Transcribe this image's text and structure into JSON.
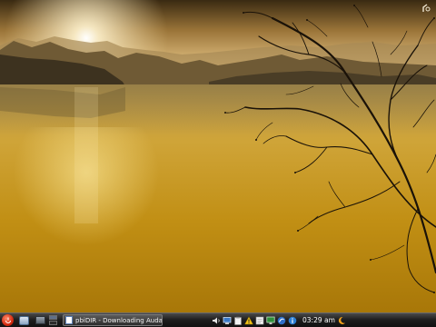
{
  "desktop": {
    "wallpaper_icon": "lake-sunset-wallpaper",
    "corner_icon": "desktop-toolbox-icon"
  },
  "taskbar": {
    "start_icon": "kde-menu-icon",
    "launchers": [
      "file-manager-icon",
      "show-desktop-icon"
    ],
    "pager": {
      "desktops": 2,
      "active": 1
    },
    "task": {
      "icon": "document-icon",
      "label": "pbiDIR - Downloading Audacity",
      "more": "›"
    },
    "tray": [
      "volume-icon",
      "network-icon",
      "clipboard-icon",
      "warning-icon",
      "notes-icon",
      "display-icon",
      "update-manager-icon",
      "info-icon"
    ],
    "clock": "03:29 am"
  },
  "colors": {
    "sky_top": "#3a2a12",
    "sky_glow": "#f4dc9a",
    "water": "#c89a1e",
    "taskbar": "#1f1f1f",
    "start_red": "#d42b10"
  }
}
